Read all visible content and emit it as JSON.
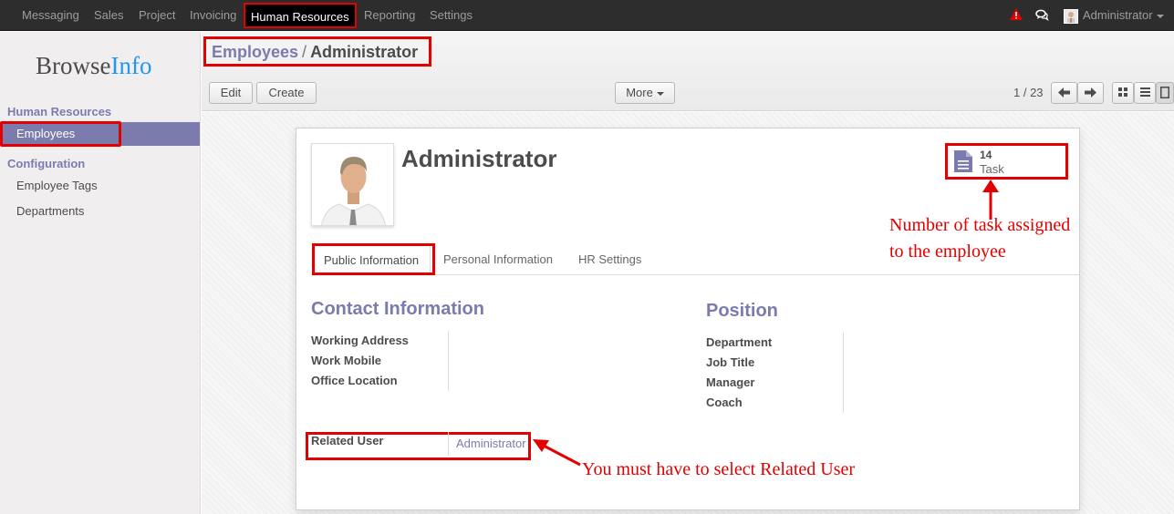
{
  "topbar": {
    "menu": [
      "Messaging",
      "Sales",
      "Project",
      "Invoicing",
      "Human Resources",
      "Reporting",
      "Settings"
    ],
    "user_name": "Administrator"
  },
  "sidebar": {
    "logo_main": "Browse",
    "logo_accent": "Info",
    "section_hr": "Human Resources",
    "item_employees": "Employees",
    "section_config": "Configuration",
    "item_employee_tags": "Employee Tags",
    "item_departments": "Departments"
  },
  "breadcrumb": {
    "parent": "Employees",
    "separator": "/",
    "current": "Administrator"
  },
  "toolbar": {
    "edit": "Edit",
    "create": "Create",
    "more": "More",
    "pager": "1 / 23"
  },
  "employee": {
    "name": "Administrator",
    "task_count": "14",
    "task_label": "Task"
  },
  "tabs": [
    "Public Information",
    "Personal Information",
    "HR Settings"
  ],
  "contact": {
    "title": "Contact Information",
    "fields": [
      "Working Address",
      "Work Mobile",
      "Office Location"
    ]
  },
  "position": {
    "title": "Position",
    "fields": [
      "Department",
      "Job Title",
      "Manager",
      "Coach"
    ]
  },
  "related_user": {
    "label": "Related User",
    "value": "Administrator"
  },
  "annotations": {
    "task_note_line1": "Number of task assigned",
    "task_note_line2": "to the employee",
    "related_note": "You must have to select Related User"
  },
  "colors": {
    "accent": "#7c7bad",
    "highlight": "#e30000",
    "topbar": "#2d2d2d"
  }
}
